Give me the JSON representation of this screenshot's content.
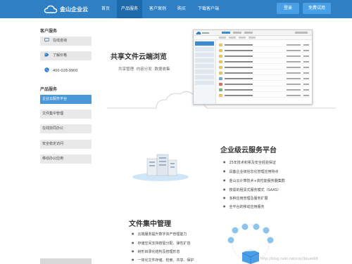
{
  "brand": {
    "name": "金山企业云"
  },
  "nav": {
    "items": [
      {
        "label": "首页"
      },
      {
        "label": "产品服务"
      },
      {
        "label": "客户案例"
      },
      {
        "label": "购买"
      },
      {
        "label": "下载客户端"
      }
    ],
    "active_index": 1,
    "login_label": "登录",
    "trial_label": "免费试用"
  },
  "sidebar": {
    "contact_title": "客户服务",
    "contact_items": [
      {
        "label": "在线咨询",
        "icon": "chat-icon"
      },
      {
        "label": "了解价格",
        "icon": "tag-icon"
      }
    ],
    "phone": "400-028-9900",
    "product_title": "产品服务",
    "product_items": [
      {
        "label": "企业云服务平台"
      },
      {
        "label": "文件集中管理"
      },
      {
        "label": "在线协同办公"
      },
      {
        "label": "安全稳定访问"
      },
      {
        "label": "移动办公应用"
      }
    ],
    "active_product_index": 0
  },
  "hero": {
    "title": "共享文件云端浏览",
    "subtitle": "共享管理  内容分发  数据收集"
  },
  "enterprise": {
    "title": "企业级云服务平台",
    "bullets": [
      "25年技术积累及安全经验保证",
      "具备企业级信息化管理应用特点",
      "金山云计算技术+高性能服务器集群",
      "按需的租赁式服务模式（SAAS）",
      "多种应用管理及服务扩展",
      "全平台的移动应用服务"
    ]
  },
  "file_mgmt": {
    "title": "文件集中管理",
    "bullets": [
      "云端服务提升数字资产管理能力",
      "存储空间支持按需分配、弹性扩容",
      "树形目录化结构及管理形态",
      "一体化文件存储、检索、共享、保护"
    ]
  },
  "watermark": "http://blog.csdn.net/co///blues68",
  "colors": {
    "nav_bg": "#2e7fc4",
    "nav_active": "#1d6aaa",
    "button_blue": "#4aa0e6",
    "sidebar_active": "#4a98d8"
  }
}
